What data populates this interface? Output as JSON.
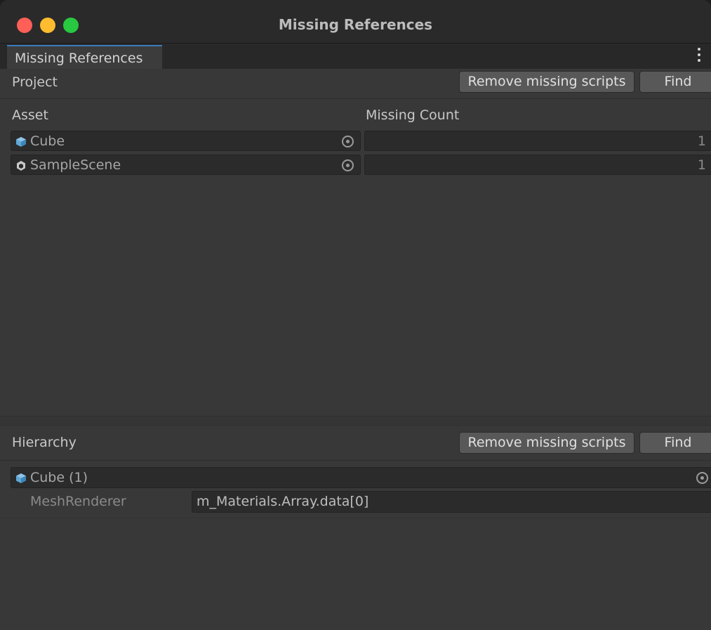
{
  "window": {
    "title": "Missing References"
  },
  "tab": {
    "label": "Missing References"
  },
  "project": {
    "title": "Project",
    "remove_label": "Remove missing scripts",
    "find_label": "Find",
    "columns": {
      "asset": "Asset",
      "missing_count": "Missing Count"
    },
    "rows": [
      {
        "name": "Cube",
        "icon": "prefab-cube-icon",
        "count": "1"
      },
      {
        "name": "SampleScene",
        "icon": "unity-scene-icon",
        "count": "1"
      }
    ]
  },
  "hierarchy": {
    "title": "Hierarchy",
    "remove_label": "Remove missing scripts",
    "find_label": "Find",
    "object": {
      "name": "Cube (1)",
      "icon": "prefab-cube-icon"
    },
    "component": "MeshRenderer",
    "property": "m_Materials.Array.data[0]"
  },
  "colors": {
    "close": "#fe5f57",
    "minimize": "#febc2e",
    "maximize": "#28c840",
    "tab_accent": "#3a79bb",
    "cube_icon": "#5fa7d6"
  }
}
